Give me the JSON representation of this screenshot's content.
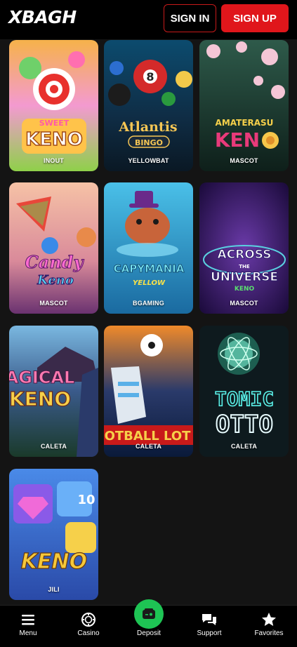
{
  "header": {
    "logo_text": "XBAGH",
    "sign_in_label": "SIGN IN",
    "sign_up_label": "SIGN UP"
  },
  "games": [
    {
      "title": "SWEET KENO",
      "provider": "INOUT"
    },
    {
      "title": "ATLANTIS BINGO",
      "provider": "YELLOWBAT"
    },
    {
      "title": "AMATERASU KENO",
      "provider": "MASCOT"
    },
    {
      "title": "The Candy Keno",
      "provider": "MASCOT"
    },
    {
      "title": "CAPYMANIA YELLOW",
      "provider": "BGAMING"
    },
    {
      "title": "ACROSS THE UNIVERSE KENO",
      "provider": "MASCOT"
    },
    {
      "title": "AGICAL KENO",
      "provider": "CALETA"
    },
    {
      "title": "OTBALL LOT",
      "provider": "CALETA"
    },
    {
      "title": "TOMIC OTTO",
      "provider": "CALETA"
    },
    {
      "title": "KENO",
      "provider": "JILI"
    }
  ],
  "bottom_nav": {
    "menu": "Menu",
    "casino": "Casino",
    "deposit": "Deposit",
    "support": "Support",
    "favorites": "Favorites"
  },
  "colors": {
    "accent_red": "#e0161b",
    "deposit_green": "#1ec454",
    "background": "#141414"
  }
}
